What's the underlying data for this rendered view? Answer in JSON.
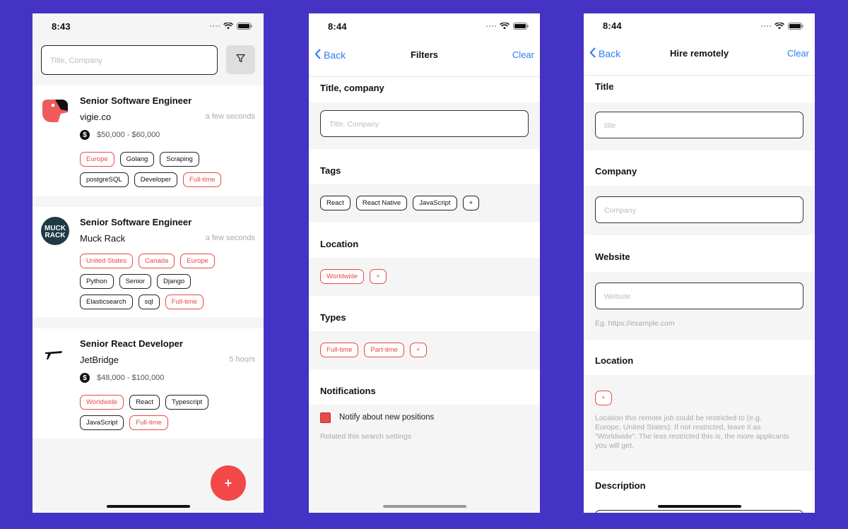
{
  "phone1": {
    "time": "8:43",
    "search": {
      "placeholder": "Title, Company"
    },
    "fab_label": "+",
    "jobs": [
      {
        "title": "Senior Software Engineer",
        "company": "vigie.co",
        "age": "a few seconds",
        "salary": "$50,000 - $60,000",
        "logo": "parrot-logo",
        "tag_rows": [
          [
            {
              "label": "Europe",
              "red": true
            },
            {
              "label": "Golang",
              "red": false
            },
            {
              "label": "Scraping",
              "red": false
            }
          ],
          [
            {
              "label": "postgreSQL",
              "red": false
            },
            {
              "label": "Developer",
              "red": false
            },
            {
              "label": "Full-time",
              "red": true
            }
          ]
        ]
      },
      {
        "title": "Senior Software Engineer",
        "company": "Muck Rack",
        "age": "a few seconds",
        "logo_text": [
          "MUCK",
          "RACK"
        ],
        "tag_rows": [
          [
            {
              "label": "United States",
              "red": true
            },
            {
              "label": "Canada",
              "red": true
            },
            {
              "label": "Europe",
              "red": true
            }
          ],
          [
            {
              "label": "Python",
              "red": false
            },
            {
              "label": "Senior",
              "red": false
            },
            {
              "label": "Django",
              "red": false
            }
          ],
          [
            {
              "label": "Elasticsearch",
              "red": false
            },
            {
              "label": "sql",
              "red": false
            },
            {
              "label": "Full-time",
              "red": true
            }
          ]
        ]
      },
      {
        "title": "Senior React Developer",
        "company": "JetBridge",
        "age": "5 hours",
        "salary": "$48,000 - $100,000",
        "logo": "jet-logo",
        "tag_rows": [
          [
            {
              "label": "Worldwide",
              "red": true
            },
            {
              "label": "React",
              "red": false
            },
            {
              "label": "Typescript",
              "red": false
            }
          ],
          [
            {
              "label": "JavaScript",
              "red": false
            },
            {
              "label": "Full-time",
              "red": true
            }
          ]
        ]
      }
    ]
  },
  "phone2": {
    "time": "8:44",
    "back": "Back",
    "title": "Filters",
    "clear": "Clear",
    "title_company_label": "Title, company",
    "title_company_placeholder": "Title, Company",
    "tags_label": "Tags",
    "tags": [
      "React",
      "React Native",
      "JavaScript",
      "+"
    ],
    "location_label": "Location",
    "locations": [
      "Worldwide",
      "+"
    ],
    "types_label": "Types",
    "types": [
      "Full-time",
      "Part-time",
      "+"
    ],
    "notifications_label": "Notifications",
    "notify_label": "Notify about new positions",
    "notify_checked": true,
    "notify_help": "Related this search settings"
  },
  "phone3": {
    "time": "8:44",
    "back": "Back",
    "title": "Hire remotely",
    "clear": "Clear",
    "title_label": "Title",
    "title_placeholder": "title",
    "company_label": "Company",
    "company_placeholder": "Company",
    "website_label": "Website",
    "website_placeholder": "Website",
    "website_help": "Eg. https://example.com",
    "location_label": "Location",
    "location_add": "+",
    "location_help": "Location this remote job could be restricted to (e.g. Europe, United States). If not restricted, leave it as \"Worldwide\". The less restricted this is, the more applicants you will get.",
    "description_label": "Description"
  },
  "colors": {
    "background": "#4433c4",
    "accent_red": "#f24848",
    "link_blue": "#2f7bf5"
  }
}
